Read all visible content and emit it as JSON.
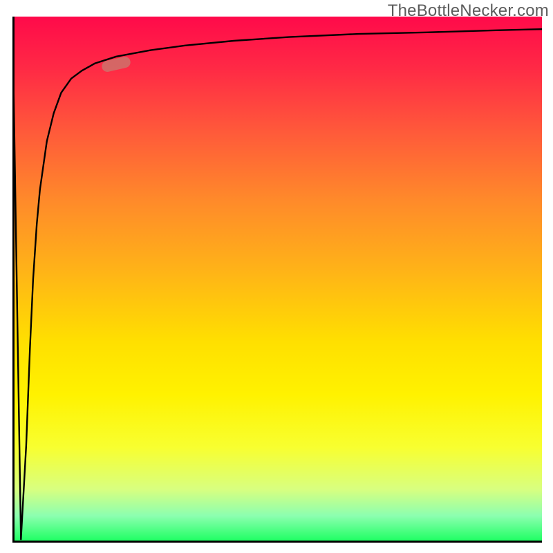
{
  "watermark": {
    "text": "TheBottleNecker.com"
  },
  "colors": {
    "gradient_top": "#ff0a4a",
    "gradient_bottom": "#1aff60",
    "axis": "#000000",
    "curve": "#000000",
    "marker": "rgba(201,120,110,0.78)",
    "watermark_text": "#5c5c5c"
  },
  "chart_data": {
    "type": "line",
    "title": "",
    "xlabel": "",
    "ylabel": "",
    "xlim": [
      0,
      100
    ],
    "ylim": [
      0,
      100
    ],
    "grid": false,
    "series": [
      {
        "name": "curve",
        "x": [
          0.0,
          1.6,
          2.6,
          3.3,
          3.9,
          4.6,
          5.2,
          6.5,
          7.8,
          9.2,
          11.1,
          13.1,
          15.6,
          19.6,
          26.1,
          32.6,
          41.8,
          52.2,
          65.3,
          78.3,
          91.4,
          100.0
        ],
        "values": [
          100.0,
          0.5,
          18.4,
          36.8,
          50.0,
          60.5,
          67.1,
          76.3,
          81.6,
          85.5,
          88.2,
          89.7,
          91.1,
          92.4,
          93.6,
          94.5,
          95.4,
          96.1,
          96.7,
          97.0,
          97.4,
          97.6
        ]
      }
    ],
    "annotations": [
      {
        "name": "marker",
        "x": 19.6,
        "y": 90.9,
        "angle_deg": -13
      }
    ]
  }
}
